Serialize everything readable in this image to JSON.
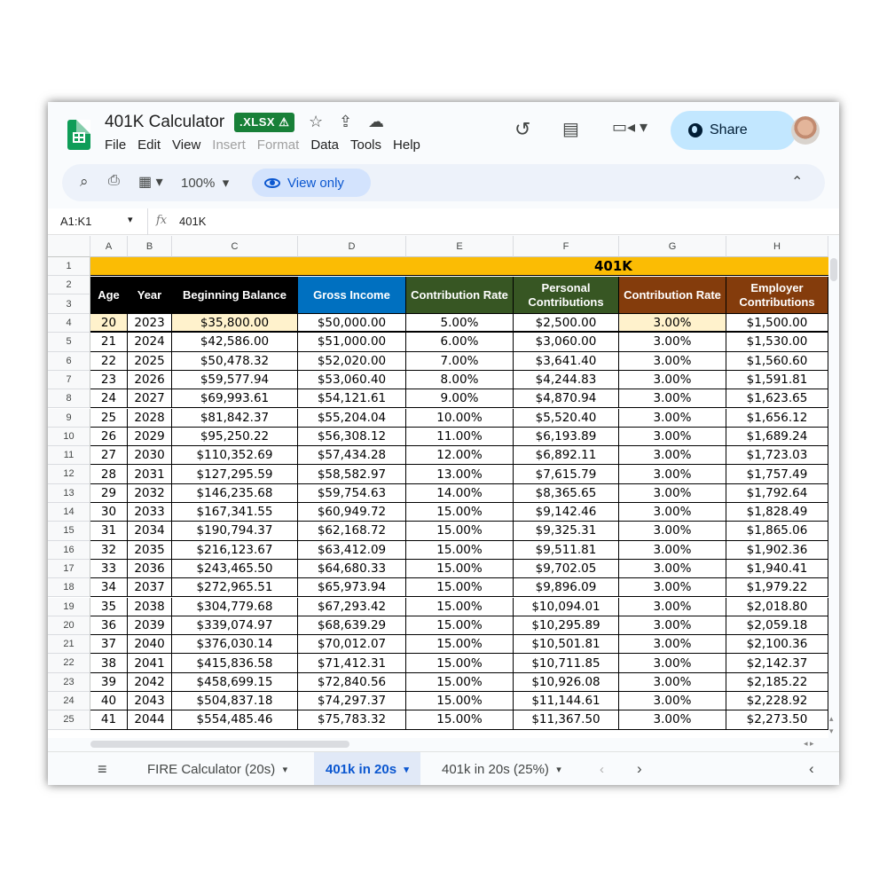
{
  "app": {
    "title": "401K Calculator",
    "badge": ".XLSX",
    "badge_warn": "⚠",
    "menu": [
      {
        "label": "File",
        "enabled": true
      },
      {
        "label": "Edit",
        "enabled": true
      },
      {
        "label": "View",
        "enabled": true
      },
      {
        "label": "Insert",
        "enabled": false
      },
      {
        "label": "Format",
        "enabled": false
      },
      {
        "label": "Data",
        "enabled": true
      },
      {
        "label": "Tools",
        "enabled": true
      },
      {
        "label": "Help",
        "enabled": true
      }
    ],
    "share_label": "Share"
  },
  "toolbar": {
    "zoom": "100%",
    "view_only_label": "View only"
  },
  "formula_bar": {
    "cell_ref": "A1:K1",
    "fx": "fx",
    "value": "401K"
  },
  "columns": [
    "A",
    "B",
    "C",
    "D",
    "E",
    "F",
    "G",
    "H"
  ],
  "sheet": {
    "banner": "401K",
    "headers": {
      "age": "Age",
      "year": "Year",
      "beginning_balance": "Beginning Balance",
      "gross_income": "Gross Income",
      "contribution_rate": "Contribution Rate",
      "personal_contributions": "Personal Contributions",
      "employer_contribution_rate": "Contribution Rate",
      "employer_contributions": "Employer Contributions"
    },
    "header_colors": {
      "age": "#000000",
      "year": "#000000",
      "beginning_balance": "#000000",
      "gross_income": "#0070c0",
      "contribution_rate": "#375623",
      "personal_contributions": "#375623",
      "employer_contribution_rate": "#843c0c",
      "employer_contributions": "#843c0c"
    },
    "banner_color": "#fbbc04",
    "input_fill": "#fff2cc",
    "row_numbers": [
      1,
      2,
      3,
      4,
      5,
      6,
      7,
      8,
      9,
      10,
      11,
      12,
      13,
      14,
      15,
      16,
      17,
      18,
      19,
      20,
      21,
      22,
      23,
      24,
      25
    ],
    "rows": [
      [
        "20",
        "2023",
        "$35,800.00",
        "$50,000.00",
        "5.00%",
        "$2,500.00",
        "3.00%",
        "$1,500.00"
      ],
      [
        "21",
        "2024",
        "$42,586.00",
        "$51,000.00",
        "6.00%",
        "$3,060.00",
        "3.00%",
        "$1,530.00"
      ],
      [
        "22",
        "2025",
        "$50,478.32",
        "$52,020.00",
        "7.00%",
        "$3,641.40",
        "3.00%",
        "$1,560.60"
      ],
      [
        "23",
        "2026",
        "$59,577.94",
        "$53,060.40",
        "8.00%",
        "$4,244.83",
        "3.00%",
        "$1,591.81"
      ],
      [
        "24",
        "2027",
        "$69,993.61",
        "$54,121.61",
        "9.00%",
        "$4,870.94",
        "3.00%",
        "$1,623.65"
      ],
      [
        "25",
        "2028",
        "$81,842.37",
        "$55,204.04",
        "10.00%",
        "$5,520.40",
        "3.00%",
        "$1,656.12"
      ],
      [
        "26",
        "2029",
        "$95,250.22",
        "$56,308.12",
        "11.00%",
        "$6,193.89",
        "3.00%",
        "$1,689.24"
      ],
      [
        "27",
        "2030",
        "$110,352.69",
        "$57,434.28",
        "12.00%",
        "$6,892.11",
        "3.00%",
        "$1,723.03"
      ],
      [
        "28",
        "2031",
        "$127,295.59",
        "$58,582.97",
        "13.00%",
        "$7,615.79",
        "3.00%",
        "$1,757.49"
      ],
      [
        "29",
        "2032",
        "$146,235.68",
        "$59,754.63",
        "14.00%",
        "$8,365.65",
        "3.00%",
        "$1,792.64"
      ],
      [
        "30",
        "2033",
        "$167,341.55",
        "$60,949.72",
        "15.00%",
        "$9,142.46",
        "3.00%",
        "$1,828.49"
      ],
      [
        "31",
        "2034",
        "$190,794.37",
        "$62,168.72",
        "15.00%",
        "$9,325.31",
        "3.00%",
        "$1,865.06"
      ],
      [
        "32",
        "2035",
        "$216,123.67",
        "$63,412.09",
        "15.00%",
        "$9,511.81",
        "3.00%",
        "$1,902.36"
      ],
      [
        "33",
        "2036",
        "$243,465.50",
        "$64,680.33",
        "15.00%",
        "$9,702.05",
        "3.00%",
        "$1,940.41"
      ],
      [
        "34",
        "2037",
        "$272,965.51",
        "$65,973.94",
        "15.00%",
        "$9,896.09",
        "3.00%",
        "$1,979.22"
      ],
      [
        "35",
        "2038",
        "$304,779.68",
        "$67,293.42",
        "15.00%",
        "$10,094.01",
        "3.00%",
        "$2,018.80"
      ],
      [
        "36",
        "2039",
        "$339,074.97",
        "$68,639.29",
        "15.00%",
        "$10,295.89",
        "3.00%",
        "$2,059.18"
      ],
      [
        "37",
        "2040",
        "$376,030.14",
        "$70,012.07",
        "15.00%",
        "$10,501.81",
        "3.00%",
        "$2,100.36"
      ],
      [
        "38",
        "2041",
        "$415,836.58",
        "$71,412.31",
        "15.00%",
        "$10,711.85",
        "3.00%",
        "$2,142.37"
      ],
      [
        "39",
        "2042",
        "$458,699.15",
        "$72,840.56",
        "15.00%",
        "$10,926.08",
        "3.00%",
        "$2,185.22"
      ],
      [
        "40",
        "2043",
        "$504,837.18",
        "$74,297.37",
        "15.00%",
        "$11,144.61",
        "3.00%",
        "$2,228.92"
      ],
      [
        "41",
        "2044",
        "$554,485.46",
        "$75,783.32",
        "15.00%",
        "$11,367.50",
        "3.00%",
        "$2,273.50"
      ]
    ]
  },
  "sheet_tabs": [
    {
      "label": "FIRE Calculator (20s)",
      "active": false
    },
    {
      "label": "401k in 20s",
      "active": true
    },
    {
      "label": "401k in 20s (25%)",
      "active": false
    }
  ],
  "icons": [
    "sheets-logo-icon",
    "star-icon",
    "move-to-drive-icon",
    "cloud-status-icon",
    "history-icon",
    "comment-icon",
    "meet-icon",
    "globe-icon",
    "search-icon",
    "print-icon",
    "format-icon",
    "eye-icon",
    "collapse-icon",
    "all-sheets-icon",
    "chevron-left-icon",
    "chevron-right-icon"
  ]
}
